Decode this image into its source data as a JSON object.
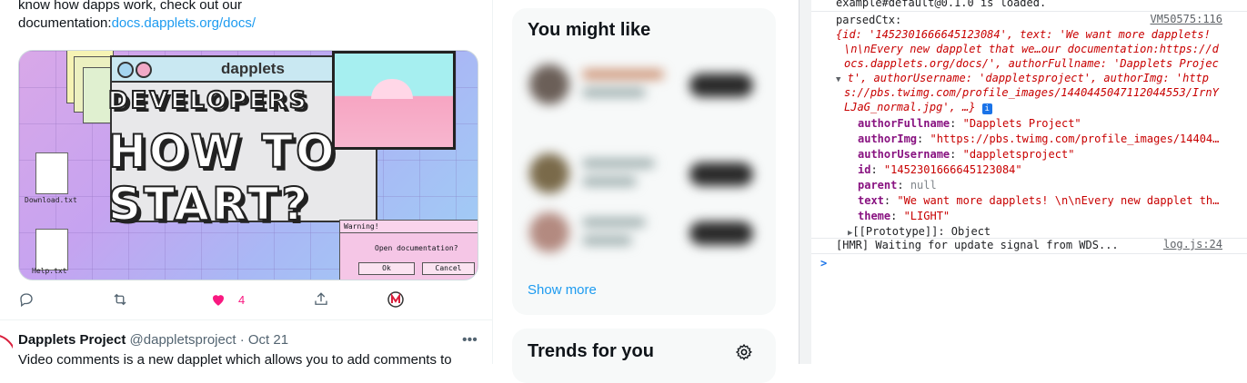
{
  "tweet": {
    "line1": "know how dapps work, check out our",
    "line2_prefix": "documentation:",
    "link": "docs.dapplets.org/docs/",
    "card": {
      "logo": "dapplets",
      "headline1": "DEVELOPERS",
      "headline2": "HOW TO",
      "headline3": "START?",
      "file1": "Download.txt",
      "file2": "Help.txt",
      "dialog_title": "Warning!",
      "dialog_message": "Open documentation?",
      "dialog_ok": "Ok",
      "dialog_cancel": "Cancel"
    },
    "likes": "4"
  },
  "next_tweet": {
    "author": "Dapplets Project",
    "handle": "@dappletsproject",
    "date": "· Oct 21",
    "text": "Video comments is a new dapplet which allows you to add comments to"
  },
  "sidebar": {
    "you_might_like": "You might like",
    "show_more": "Show more",
    "trends": "Trends for you"
  },
  "console": {
    "top_line": "example#default@0.1.0 is loaded.",
    "label": "parsedCtx:",
    "src1": "VM50575:116",
    "summary": [
      "{id: '1452301666645123084', text: 'We want more dapplets!",
      "\\n\\nEvery new dapplet that we…our documentation:https://d",
      "ocs.dapplets.org/docs/', authorFullname: 'Dapplets Projec",
      "t', authorUsername: 'dappletsproject', authorImg: 'http",
      "s://pbs.twimg.com/profile_images/1440445047112044553/IrnY",
      "LJaG_normal.jpg', …}"
    ],
    "props": [
      {
        "key": "authorFullname",
        "value": "\"Dapplets Project\""
      },
      {
        "key": "authorImg",
        "value": "\"https://pbs.twimg.com/profile_images/14404…"
      },
      {
        "key": "authorUsername",
        "value": "\"dappletsproject\""
      },
      {
        "key": "id",
        "value": "\"1452301666645123084\""
      },
      {
        "key": "parent",
        "value": "null"
      },
      {
        "key": "text",
        "value": "\"We want more dapplets! \\n\\nEvery new dapplet th…"
      },
      {
        "key": "theme",
        "value": "\"LIGHT\""
      }
    ],
    "prototype": "[[Prototype]]: Object",
    "hmr": "[HMR] Waiting for update signal from WDS...",
    "src2": "log.js:24",
    "prompt": ">"
  }
}
